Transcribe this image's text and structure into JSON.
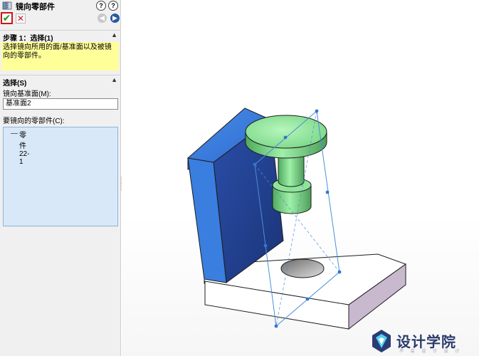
{
  "panel": {
    "title": "镜向零部件",
    "help1": "?",
    "help2": "?",
    "ok_symbol": "✔",
    "cancel_symbol": "✕",
    "back_symbol": "◀",
    "forward_symbol": "▶"
  },
  "step_section": {
    "title": "步骤 1：选择(1)",
    "message": "选择镜向所用的面/基准面以及被镜向的零部件。"
  },
  "selection_section": {
    "title": "选择(S)",
    "mirror_plane_label": "镜向基准面(M):",
    "mirror_plane_value": "基准面2",
    "components_label": "要镜向的零部件(C):",
    "components": [
      "零件22-1"
    ]
  },
  "watermark": {
    "text": "设计学院",
    "sub": "不 会 设 计 设 计"
  },
  "colors": {
    "accent_red": "#d0121b",
    "ok_green": "#1a9a1a",
    "message_yellow": "#ffff99",
    "list_blue": "#d8e8f8",
    "part_blue": "#2f6fd0",
    "part_green": "#7dde8c"
  }
}
